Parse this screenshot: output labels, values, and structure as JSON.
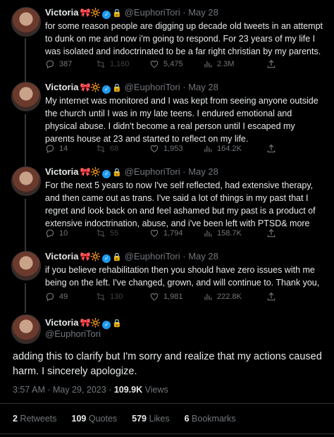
{
  "author": {
    "name": "Victoria",
    "emojis": "🎀🔆",
    "handle": "@EuphoriTori"
  },
  "tweets": [
    {
      "date": "May 28",
      "text": "for some reason people are digging up decade old tweets in an attempt to dunk on me and now i'm going to respond. For 23 years of my life I was isolated and indoctrinated to be a far right christian by my parents.",
      "replies": "387",
      "retweets": "1,160",
      "likes": "5,475",
      "views": "2.3M"
    },
    {
      "date": "May 28",
      "text": "My internet was monitored and I was kept from seeing anyone outside the church until I was in my late teens. I endured emotional and physical abuse. I didn't become a real person until I escaped my parents house at 23 and started to reflect on my life.",
      "replies": "14",
      "retweets": "68",
      "likes": "1,953",
      "views": "164.2K"
    },
    {
      "date": "May 28",
      "text": "For the next 5 years to now I've self reflected, had extensive therapy, and then came out as trans. I've said a lot of things in my past that I regret and look back on and feel ashamed but my past is a product of extensive indoctrination, abuse, and i've been left with PTSD& more",
      "replies": "10",
      "retweets": "55",
      "likes": "1,794",
      "views": "158.7K"
    },
    {
      "date": "May 28",
      "text": "if you believe rehabilitation then you should have zero issues with me being on the left. I've changed, grown, and will continue to. Thank you,",
      "replies": "49",
      "retweets": "130",
      "likes": "1,981",
      "views": "222.8K"
    }
  ],
  "main_tweet": {
    "text": "adding this to clarify but I'm sorry and realize that my actions caused harm. I sincerely apologize.",
    "time": "3:57 AM · May 29, 2023 · ",
    "views_count": "109.9K",
    "views_label": " Views",
    "retweets_count": "2",
    "retweets_label": " Retweets",
    "quotes_count": "109",
    "quotes_label": " Quotes",
    "likes_count": "579",
    "likes_label": " Likes",
    "bookmarks_count": "6",
    "bookmarks_label": " Bookmarks"
  },
  "colors": {
    "background": "#000000",
    "text": "#e7e9ea",
    "secondary": "#71767b",
    "verified": "#1d9bf0"
  }
}
